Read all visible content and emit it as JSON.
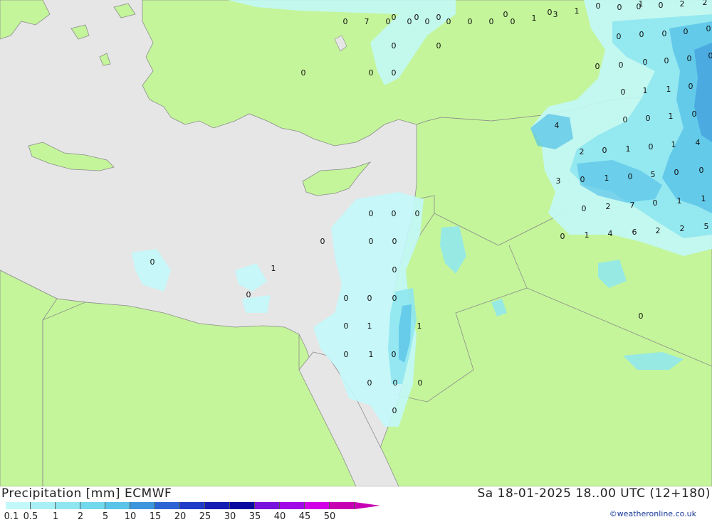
{
  "map": {
    "colors": {
      "sea": "#e6e6e6",
      "land": "#c4f59a",
      "border": "#8c8c8c",
      "precip_light": "#c3f8fa",
      "precip_mid": "#8fe6f0",
      "precip_heavy": "#5ac4e8",
      "precip_strong": "#3c96dc"
    },
    "labels": [
      "0",
      "0",
      "0",
      "0",
      "0",
      "0",
      "0",
      "0",
      "0",
      "0",
      "0",
      "0",
      "0",
      "0",
      "0",
      "0",
      "0",
      "0",
      "0",
      "1",
      "0",
      "0",
      "0",
      "0",
      "0",
      "0",
      "1",
      "1",
      "0",
      "1",
      "0",
      "0",
      "0",
      "0",
      "0",
      "0",
      "0",
      "0",
      "0",
      "0",
      "0",
      "0",
      "0",
      "0",
      "0",
      "0",
      "0",
      "0",
      "1",
      "1",
      "0",
      "0",
      "0",
      "1",
      "0",
      "4",
      "2",
      "0",
      "1",
      "0",
      "1",
      "4",
      "3",
      "0",
      "1",
      "0",
      "5",
      "0",
      "0",
      "0",
      "2",
      "7",
      "0",
      "1",
      "1",
      "0",
      "1",
      "4",
      "6",
      "2",
      "2",
      "5",
      "2",
      "2",
      "1",
      "0",
      "0",
      "1",
      "3",
      "1",
      "0",
      "0",
      "0",
      "0",
      "0",
      "0",
      "0",
      "7",
      "0"
    ]
  },
  "footer": {
    "title_left": "Precipitation [mm] ECMWF",
    "title_right": "Sa 18-01-2025 18..00 UTC (12+180)",
    "credit": "©weatheronline.co.uk",
    "scale": [
      {
        "label": "0.1",
        "color": "#c3f8fa"
      },
      {
        "label": "0.5",
        "color": "#a8f0f5"
      },
      {
        "label": "1",
        "color": "#8fe6f0"
      },
      {
        "label": "2",
        "color": "#72d8ec"
      },
      {
        "label": "5",
        "color": "#5ac4e8"
      },
      {
        "label": "10",
        "color": "#3c96dc"
      },
      {
        "label": "15",
        "color": "#2c64d4"
      },
      {
        "label": "20",
        "color": "#1e3cc8"
      },
      {
        "label": "25",
        "color": "#141eb4"
      },
      {
        "label": "30",
        "color": "#0a0aa0"
      },
      {
        "label": "35",
        "color": "#7814dc"
      },
      {
        "label": "40",
        "color": "#a00ae6"
      },
      {
        "label": "45",
        "color": "#d200e6"
      },
      {
        "label": "50",
        "color": "#c800b4"
      }
    ]
  }
}
